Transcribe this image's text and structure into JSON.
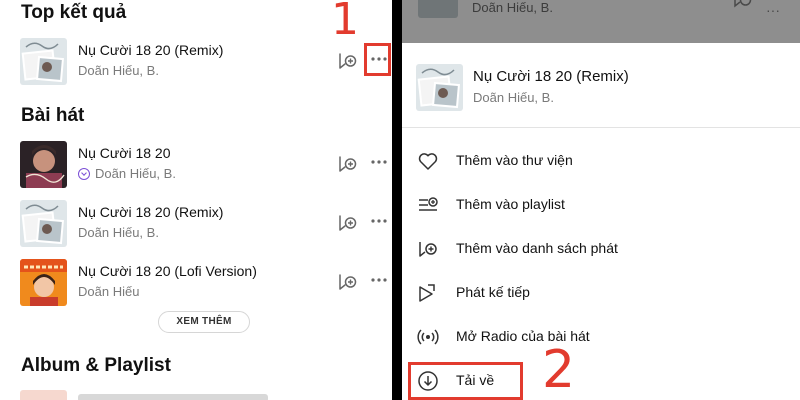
{
  "left_panel": {
    "top_result": {
      "heading": "Top kết quả",
      "song": {
        "title": "Nụ Cười 18 20 (Remix)",
        "artist": "Doãn Hiếu, B."
      }
    },
    "songs_section": {
      "heading": "Bài hát",
      "songs": [
        {
          "title": "Nụ Cười 18 20",
          "artist": "Doãn Hiếu, B.",
          "downloaded": true
        },
        {
          "title": "Nụ Cười 18 20 (Remix)",
          "artist": "Doãn Hiếu, B.",
          "downloaded": false
        },
        {
          "title": "Nụ Cười 18 20 (Lofi Version)",
          "artist": "Doãn Hiếu",
          "downloaded": false
        }
      ],
      "see_more_label": "XEM THÊM"
    },
    "album_section": {
      "heading": "Album & Playlist"
    },
    "step_marker": "1"
  },
  "right_panel": {
    "header_artist": "Doãn Hiếu, B.",
    "sheet": {
      "song": {
        "title": "Nụ Cười 18 20 (Remix)",
        "artist": "Doãn Hiếu, B."
      },
      "actions": [
        {
          "label": "Thêm vào thư viện",
          "icon": "heart-icon"
        },
        {
          "label": "Thêm vào playlist",
          "icon": "add-playlist-icon"
        },
        {
          "label": "Thêm vào danh sách phát",
          "icon": "add-to-queue-icon"
        },
        {
          "label": "Phát kế tiếp",
          "icon": "play-next-icon"
        },
        {
          "label": "Mở Radio của bài hát",
          "icon": "radio-icon"
        },
        {
          "label": "Tải về",
          "icon": "download-icon"
        }
      ]
    },
    "step_marker": "2"
  },
  "colors": {
    "highlight": "#e23b2e",
    "accent": "#7b4fd6",
    "header_overlay": "#8e8e8e"
  }
}
